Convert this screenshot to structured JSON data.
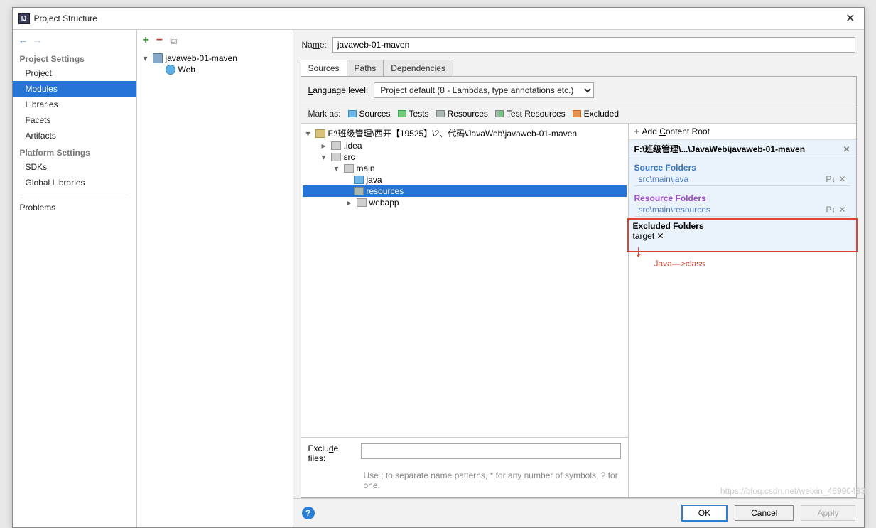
{
  "window": {
    "title": "Project Structure"
  },
  "sidebar": {
    "groups": [
      {
        "title": "Project Settings",
        "items": [
          "Project",
          "Modules",
          "Libraries",
          "Facets",
          "Artifacts"
        ],
        "selected": 1
      },
      {
        "title": "Platform Settings",
        "items": [
          "SDKs",
          "Global Libraries"
        ]
      }
    ],
    "problems": "Problems"
  },
  "module_tree": {
    "root": "javaweb-01-maven",
    "children": [
      "Web"
    ]
  },
  "main": {
    "name_label": "Name:",
    "name_value": "javaweb-01-maven",
    "tabs": [
      "Sources",
      "Paths",
      "Dependencies"
    ],
    "active_tab": 0,
    "language_level_label": "Language level:",
    "language_level_value": "Project default (8 - Lambdas, type annotations etc.)",
    "mark_as_label": "Mark as:",
    "mark_buttons": [
      "Sources",
      "Tests",
      "Resources",
      "Test Resources",
      "Excluded"
    ],
    "tree": {
      "root": "F:\\班级管理\\西开【19525】\\2、代码\\JavaWeb\\javaweb-01-maven",
      "nodes": [
        {
          "depth": 1,
          "expand": "closed",
          "label": ".idea",
          "type": "generic"
        },
        {
          "depth": 1,
          "expand": "open",
          "label": "src",
          "type": "generic"
        },
        {
          "depth": 2,
          "expand": "open",
          "label": "main",
          "type": "generic"
        },
        {
          "depth": 3,
          "expand": "none",
          "label": "java",
          "type": "blue"
        },
        {
          "depth": 3,
          "expand": "none",
          "label": "resources",
          "type": "res",
          "selected": true
        },
        {
          "depth": 3,
          "expand": "closed",
          "label": "webapp",
          "type": "generic"
        }
      ]
    },
    "exclude_files_label": "Exclude files:",
    "exclude_files_value": "",
    "exclude_hint": "Use ; to separate name patterns, * for any number of symbols, ? for one."
  },
  "content_root": {
    "add_label": "Add Content Root",
    "path": "F:\\班级管理\\...\\JavaWeb\\javaweb-01-maven",
    "source_folders": {
      "title": "Source Folders",
      "items": [
        "src\\main\\java"
      ]
    },
    "resource_folders": {
      "title": "Resource Folders",
      "items": [
        "src\\main\\resources"
      ]
    },
    "excluded_folders": {
      "title": "Excluded Folders",
      "items": [
        "target"
      ]
    }
  },
  "annotation": "Java—>class",
  "footer": {
    "ok": "OK",
    "cancel": "Cancel",
    "apply": "Apply"
  },
  "watermark": "https://blog.csdn.net/weixin_46990483"
}
